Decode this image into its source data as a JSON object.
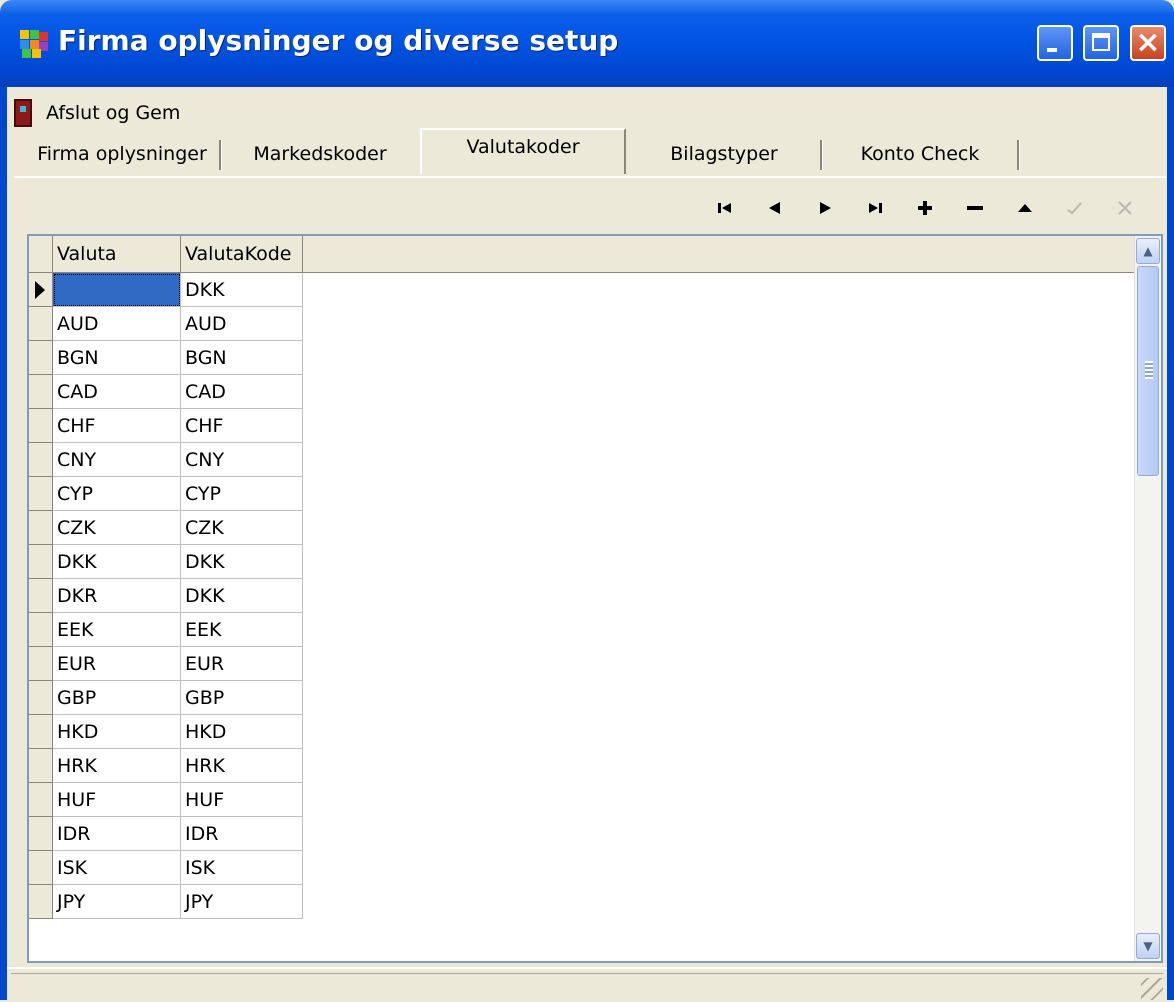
{
  "window": {
    "title": "Firma oplysninger og diverse setup",
    "controls": [
      "minimize-icon",
      "maximize-icon",
      "close-icon"
    ]
  },
  "toolbar": {
    "exit_icon": "door-exit-icon",
    "exit_label": "Afslut og Gem"
  },
  "tabs": [
    {
      "label": "Firma oplysninger",
      "active": false
    },
    {
      "label": "Markedskoder",
      "active": false
    },
    {
      "label": "Valutakoder",
      "active": true
    },
    {
      "label": "Bilagstyper",
      "active": false
    },
    {
      "label": "Konto Check",
      "active": false
    }
  ],
  "navigator": [
    {
      "name": "first-record-icon",
      "enabled": true
    },
    {
      "name": "prior-record-icon",
      "enabled": true
    },
    {
      "name": "next-record-icon",
      "enabled": true
    },
    {
      "name": "last-record-icon",
      "enabled": true
    },
    {
      "name": "insert-record-icon",
      "enabled": true
    },
    {
      "name": "delete-record-icon",
      "enabled": true
    },
    {
      "name": "edit-record-icon",
      "enabled": true
    },
    {
      "name": "post-record-icon",
      "enabled": false
    },
    {
      "name": "cancel-record-icon",
      "enabled": false
    }
  ],
  "grid": {
    "columns": [
      "Valuta",
      "ValutaKode"
    ],
    "rows": [
      [
        "",
        "DKK"
      ],
      [
        "AUD",
        "AUD"
      ],
      [
        "BGN",
        "BGN"
      ],
      [
        "CAD",
        "CAD"
      ],
      [
        "CHF",
        "CHF"
      ],
      [
        "CNY",
        "CNY"
      ],
      [
        "CYP",
        "CYP"
      ],
      [
        "CZK",
        "CZK"
      ],
      [
        "DKK",
        "DKK"
      ],
      [
        "DKR",
        "DKK"
      ],
      [
        "EEK",
        "EEK"
      ],
      [
        "EUR",
        "EUR"
      ],
      [
        "GBP",
        "GBP"
      ],
      [
        "HKD",
        "HKD"
      ],
      [
        "HRK",
        "HRK"
      ],
      [
        "HUF",
        "HUF"
      ],
      [
        "IDR",
        "IDR"
      ],
      [
        "ISK",
        "ISK"
      ],
      [
        "JPY",
        "JPY"
      ]
    ],
    "current_row": 0
  },
  "colors": {
    "titlebar": "#0053e3",
    "selection": "#316ac5",
    "face": "#ece9d8"
  }
}
